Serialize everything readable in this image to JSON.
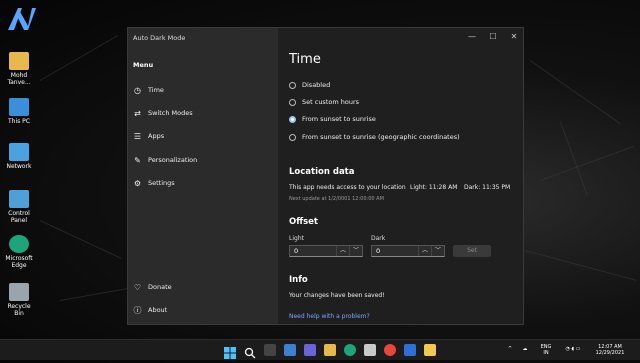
{
  "desktop": {
    "icons": [
      {
        "label": "Mohd Tanve..."
      },
      {
        "label": "This PC"
      },
      {
        "label": "Network"
      },
      {
        "label": "Control Panel"
      },
      {
        "label": "Microsoft Edge"
      },
      {
        "label": "Recycle Bin"
      }
    ]
  },
  "window": {
    "title": "Auto Dark Mode",
    "caption_buttons": {
      "minimize": "—",
      "maximize": "☐",
      "close": "✕"
    }
  },
  "sidebar": {
    "menu_title": "Menu",
    "items": [
      {
        "label": "Time",
        "icon": "clock-icon"
      },
      {
        "label": "Switch Modes",
        "icon": "switch-icon"
      },
      {
        "label": "Apps",
        "icon": "list-icon"
      },
      {
        "label": "Personalization",
        "icon": "palette-icon"
      },
      {
        "label": "Settings",
        "icon": "gear-icon"
      }
    ],
    "bottom_items": [
      {
        "label": "Donate",
        "icon": "heart-icon"
      },
      {
        "label": "About",
        "icon": "info-icon"
      }
    ]
  },
  "time_page": {
    "title": "Time",
    "options": [
      {
        "label": "Disabled",
        "selected": false
      },
      {
        "label": "Set custom hours",
        "selected": false
      },
      {
        "label": "From sunset to sunrise",
        "selected": true
      },
      {
        "label": "From sunset to sunrise (geographic coordinates)",
        "selected": false
      }
    ],
    "location": {
      "heading": "Location data",
      "message": "This app needs access to your location",
      "light": "Light: 11:28 AM",
      "dark": "Dark: 11:35 PM",
      "next_update": "Next update at 1/2/0001 12:00:00 AM"
    },
    "offset": {
      "heading": "Offset",
      "light_label": "Light",
      "light_value": "0",
      "dark_label": "Dark",
      "dark_value": "0",
      "set_label": "Set"
    },
    "info": {
      "heading": "Info",
      "message": "Your changes have been saved!",
      "help_link": "Need help with a problem?"
    }
  },
  "taskbar": {
    "language": "ENG",
    "region": "IN",
    "time": "12:07 AM",
    "date": "12/29/2021"
  }
}
